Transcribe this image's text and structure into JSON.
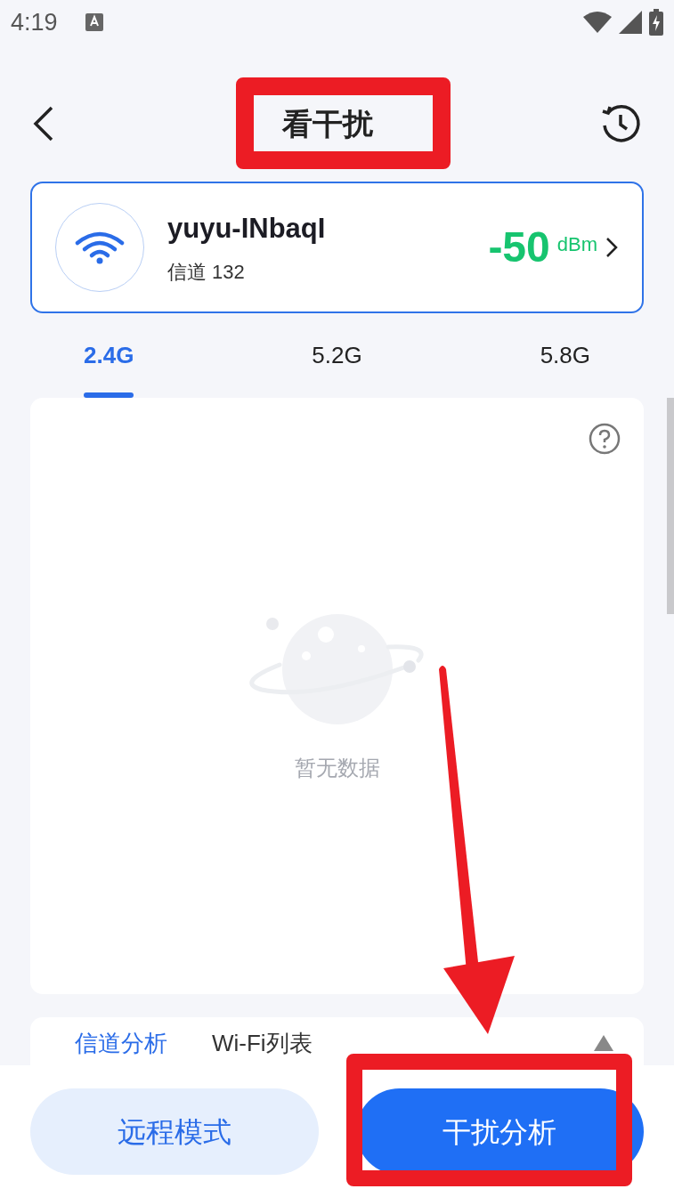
{
  "status_bar": {
    "time": "4:19"
  },
  "header": {
    "title": "看干扰"
  },
  "network": {
    "name": "yuyu-INbaqI",
    "channel": "信道 132",
    "signal": "-50",
    "unit": "dBm"
  },
  "bands": [
    {
      "label": "2.4G",
      "selected": true
    },
    {
      "label": "5.2G",
      "selected": false
    },
    {
      "label": "5.8G",
      "selected": false
    }
  ],
  "chart_panel": {
    "empty_text": "暂无数据"
  },
  "analysis_tabs": [
    {
      "label": "信道分析",
      "selected": true
    },
    {
      "label": "Wi-Fi列表",
      "selected": false
    }
  ],
  "buttons": [
    {
      "label": "远程模式",
      "kind": "secondary"
    },
    {
      "label": "干扰分析",
      "kind": "primary"
    }
  ]
}
